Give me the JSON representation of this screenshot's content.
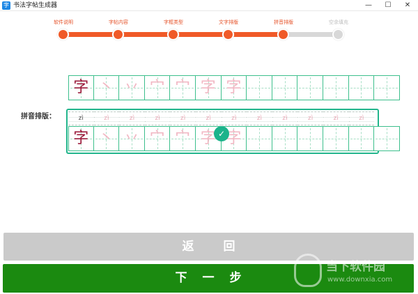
{
  "window": {
    "title": "书法字帖生成器",
    "icon_name": "app-icon",
    "controls": {
      "minimize": "—",
      "maximize": "☐",
      "close": "✕"
    }
  },
  "steps": [
    {
      "label": "软件说明",
      "state": "done"
    },
    {
      "label": "字帖内容",
      "state": "done"
    },
    {
      "label": "字框类型",
      "state": "done"
    },
    {
      "label": "文字排版",
      "state": "done"
    },
    {
      "label": "拼音排版",
      "state": "current"
    },
    {
      "label": "空余填充",
      "state": "todo"
    }
  ],
  "colors": {
    "accent": "#f05a28",
    "inactive": "#d8d8d8",
    "grid": "#3cbf8c",
    "selected": "#22b58c",
    "next_button": "#1b8a10",
    "back_button": "#cacaca"
  },
  "preview_row": {
    "cells": [
      "字",
      "丶",
      "丷",
      "宀",
      "宀",
      "字",
      "字",
      "",
      "",
      "",
      "",
      "",
      ""
    ],
    "colors": [
      "#9b1c3c",
      "#f2b8c4",
      "#f2b8c4",
      "#f2b8c4",
      "#f2b8c4",
      "#f2b8c4",
      "#f2b8c4",
      "",
      "",
      "",
      "",
      "",
      ""
    ]
  },
  "pinyin_section": {
    "label": "拼音排版：",
    "pinyin": [
      "zì",
      "zì",
      "zì",
      "zì",
      "zì",
      "zì",
      "zì",
      "zì",
      "zì",
      "zì",
      "zì",
      "zì"
    ],
    "cells": [
      "字",
      "丶",
      "丷",
      "宀",
      "宀",
      "字",
      "字",
      "",
      "",
      "",
      "",
      "",
      ""
    ],
    "colors": [
      "#9b1c3c",
      "#f2b8c4",
      "#f2b8c4",
      "#f2b8c4",
      "#f2b8c4",
      "#f2b8c4",
      "#f2b8c4",
      "",
      "",
      "",
      "",
      "",
      ""
    ],
    "selected_icon": "check-icon",
    "check_glyph": "✓"
  },
  "buttons": {
    "back_label": "返回",
    "next_label": "下一步"
  },
  "watermark": {
    "text": "当下软件园",
    "url": "www.downxia.com"
  }
}
